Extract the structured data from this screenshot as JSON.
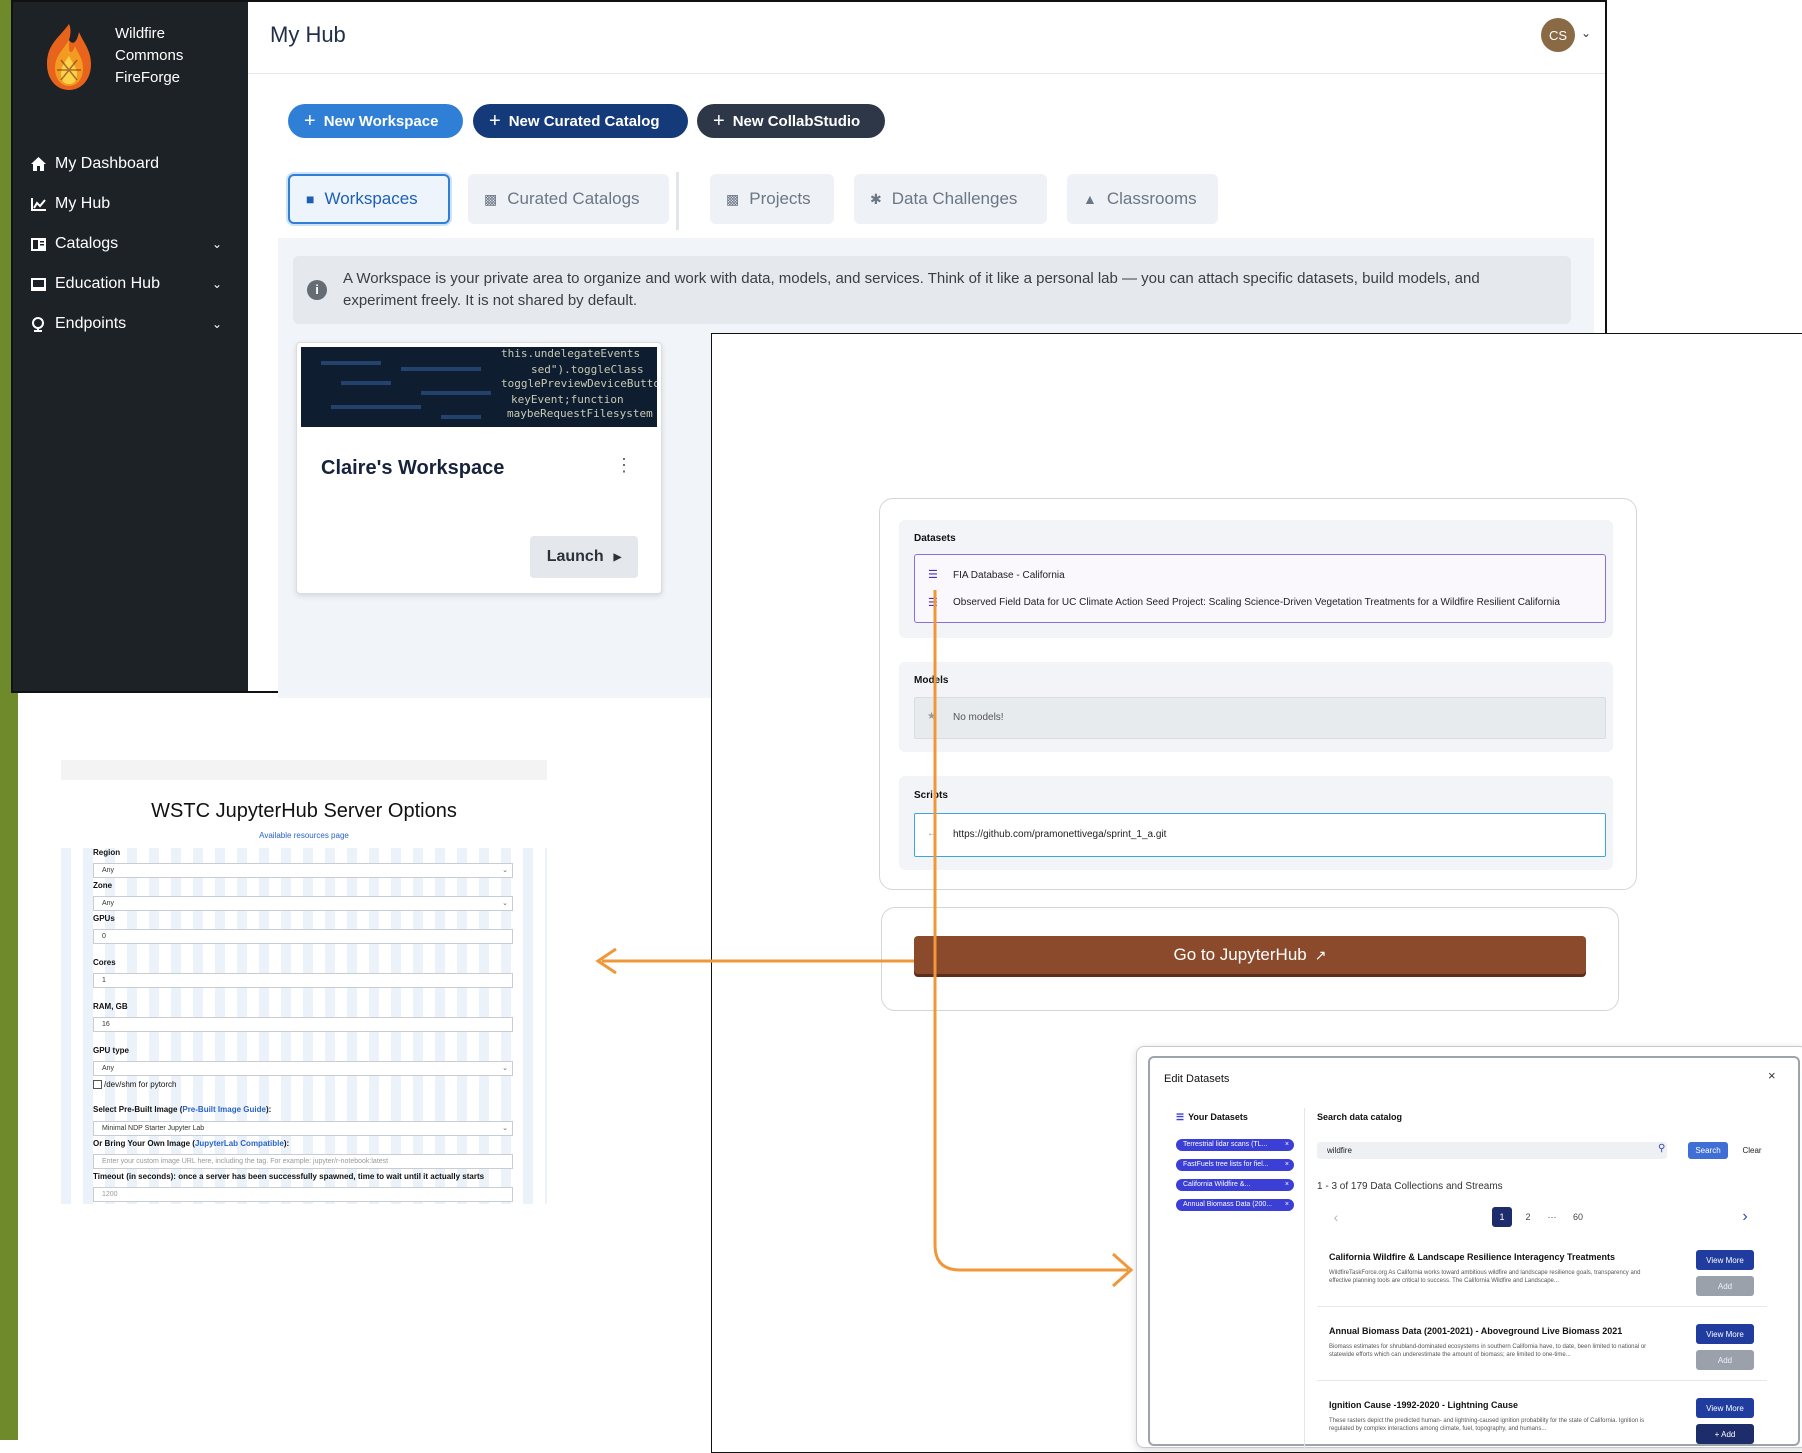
{
  "hub": {
    "brand": {
      "line1": "Wildfire",
      "line2": "Commons",
      "line3": "FireForge"
    },
    "nav": [
      {
        "label": "My Dashboard",
        "icon": "home-icon"
      },
      {
        "label": "My Hub",
        "icon": "chart-icon"
      },
      {
        "label": "Catalogs",
        "icon": "book-icon",
        "expandable": true
      },
      {
        "label": "Education Hub",
        "icon": "monitor-icon",
        "expandable": true
      },
      {
        "label": "Endpoints",
        "icon": "globe-icon",
        "expandable": true
      }
    ],
    "page_title": "My Hub",
    "avatar_initials": "CS",
    "actions": {
      "new_workspace": "New Workspace",
      "new_catalog": "New Curated Catalog",
      "new_collab": "New CollabStudio"
    },
    "tabs": [
      "Workspaces",
      "Curated Catalogs",
      "Projects",
      "Data Challenges",
      "Classrooms"
    ],
    "active_tab": "Workspaces",
    "info_text": "A Workspace is your private area to organize and work with data, models, and services. Think of it like a personal lab — you can attach specific datasets, build models, and experiment freely. It is not shared by default.",
    "workspace_card": {
      "title": "Claire's Workspace",
      "launch_label": "Launch",
      "banner_code": [
        "this.undelegateEvents",
        "sed\").toggleClass",
        "togglePreviewDeviceButton",
        "keyEvent;function",
        "maybeRequestFilesystem"
      ]
    }
  },
  "workspace_detail": {
    "datasets_label": "Datasets",
    "datasets": [
      "FIA Database - California",
      "Observed Field Data for UC Climate Action Seed Project: Scaling Science-Driven Vegetation Treatments for a Wildfire Resilient California"
    ],
    "models_label": "Models",
    "models_empty": "No models!",
    "scripts_label": "Scripts",
    "script_url": "https://github.com/pramonettivega/sprint_1_a.git",
    "jupyter_button": "Go to JupyterHub"
  },
  "jupyter_options": {
    "title": "WSTC JupyterHub Server Options",
    "resources_link": "Available resources page",
    "region_label": "Region",
    "region_value": "Any",
    "zone_label": "Zone",
    "zone_value": "Any",
    "gpus_label": "GPUs",
    "gpus_value": "0",
    "cores_label": "Cores",
    "cores_value": "1",
    "ram_label": "RAM, GB",
    "ram_value": "16",
    "gpu_type_label": "GPU type",
    "gpu_type_value": "Any",
    "shm_label": "/dev/shm for pytorch",
    "image_label_pre": "Select Pre-Built Image (",
    "image_guide_link": "Pre-Built Image Guide",
    "image_label_post": "):",
    "image_value": "Minimal NDP Starter Jupyter Lab",
    "own_image_label_pre": "Or Bring Your Own Image (",
    "own_image_link": "JupyterLab Compatible",
    "own_image_label_post": "):",
    "own_image_placeholder": "Enter your custom image URL here, including the tag. For example: jupyter/r-notebook:latest",
    "timeout_label": "Timeout (in seconds): once a server has been successfully spawned, time to wait until it actually starts",
    "timeout_value": "1200"
  },
  "edit_datasets": {
    "title": "Edit Datasets",
    "close": "×",
    "your_datasets_label": "Your Datasets",
    "chips": [
      "Terrestrial lidar scans (TL...",
      "FastFuels tree lists for fiel...",
      "California Wildfire &...",
      "Annual Biomass Data (200..."
    ],
    "search_label": "Search data catalog",
    "search_value": "wildfire",
    "search_button": "Search",
    "clear_button": "Clear",
    "results_summary": "1 - 3 of 179  Data Collections and Streams",
    "pages": [
      "1",
      "2",
      "···",
      "60"
    ],
    "results": [
      {
        "title": "California Wildfire & Landscape Resilience Interagency Treatments",
        "desc": "WildfireTaskForce.org As California works toward ambitious wildfire and landscape resilience goals, transparency and effective planning tools are critical to success. The California Wildfire and Landscape...",
        "view_label": "View More",
        "add_label": "Add",
        "added": true
      },
      {
        "title": "Annual Biomass Data (2001-2021) - Aboveground Live Biomass 2021",
        "desc": "Biomass estimates for shrubland-dominated ecosystems in southern California have, to date, been limited to national or statewide efforts which can underestimate the amount of biomass; are limited to one-time...",
        "view_label": "View More",
        "add_label": "Add",
        "added": true
      },
      {
        "title": "Ignition Cause -1992-2020 - Lightning Cause",
        "desc": "These rasters depict the predicted human- and lightning-caused ignition probability for the state of California. Ignition is regulated by complex interactions among climate, fuel, topography, and humans...",
        "view_label": "View More",
        "add_label": "+ Add",
        "added": false
      }
    ]
  },
  "colors": {
    "sidebar_bg": "#1d2226",
    "primary_blue": "#2f7fd6",
    "navy": "#143a7a",
    "dark_slate": "#2d3748",
    "jupyter_brown": "#8c4a2c",
    "arrow_orange": "#f0973a",
    "chip_purple": "#3b3fd6"
  }
}
